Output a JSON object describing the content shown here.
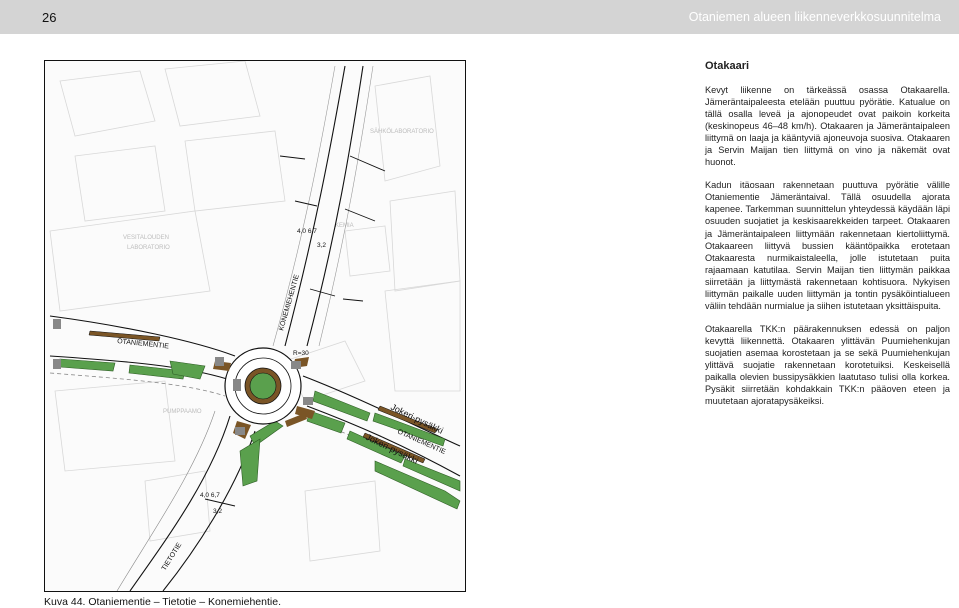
{
  "header": {
    "page_number": "26",
    "title": "Otaniemen alueen liikenneverkkosuunnitelma"
  },
  "map": {
    "street_labels": {
      "otaniementie_west": "OTANIEMENTIE",
      "konemiehentie": "KONEMIEHENTIE",
      "otaniementie_east": "OTANIEMENTIE",
      "tietotie": "TIETOTIE"
    },
    "stop_labels": {
      "jokeri_stop_north": "Jokeri-pysäkki",
      "jokeri_stop_south": "Jokeri-pysäkki"
    },
    "dimension_labels": {
      "north_widths": "4,0 6,7",
      "north_extra": "3,2",
      "south_widths": "4,0 6,7",
      "south_extra": "3,2",
      "roundabout_radius": "R=30"
    },
    "background_labels": {
      "lab_name": "VESITALOUDEN",
      "lab_name2": "LABORATORIO",
      "sahko": "SÄHKÖLABORATORIO",
      "kemia": "KEMIA",
      "pumppaamo": "PUMPPAAMO"
    }
  },
  "caption": "Kuva 44.  Otaniementie – Tietotie – Konemiehentie.",
  "text": {
    "title": "Otakaari",
    "paragraphs": [
      "Kevyt liikenne on tärkeässä osassa Otakaarella. Jämeräntaipaleesta etelään puuttuu pyörätie. Katualue on tällä osalla leveä ja ajonopeudet ovat paikoin korkeita (keskinopeus 46–48 km/h). Otakaaren ja Jämeräntaipaleen liittymä on laaja ja kääntyviä ajoneuvoja suosiva. Otakaaren ja Servin Maijan tien liittymä on vino ja näkemät ovat huonot.",
      "Kadun itäosaan rakennetaan puuttuva pyörätie välille Otaniementie Jämeräntaival. Tällä osuudella ajorata kapenee. Tarkemman suunnittelun yhteydessä käydään läpi osuuden suojatiet ja keskisaarekkeiden tarpeet. Otakaaren ja Jämeräntaipaleen liittymään rakennetaan kiertoliittymä. Otakaareen liittyvä bussien kääntöpaikka erotetaan Otakaaresta nurmikaistaleella, jolle istutetaan puita rajaamaan katutilaa. Servin Maijan tien liittymän paikkaa siirretään ja liittymästä rakennetaan kohtisuora. Nykyisen liittymän paikalle uuden liittymän ja tontin pysäköintialueen väliin tehdään nurmialue ja siihen istutetaan yksittäispuita.",
      "Otakaarella TKK:n päärakennuksen edessä on paljon kevyttä liikennettä. Otakaaren ylittävän Puumiehenkujan suojatien asemaa korostetaan ja se sekä Puumiehenkujan ylittävä suojatie rakennetaan korotetuiksi. Keskeisellä paikalla olevien bussipysäkkien laatutaso tulisi olla korkea. Pysäkit siirretään kohdakkain TKK:n pääoven eteen ja muutetaan ajoratapysäkeiksi."
    ]
  },
  "colors": {
    "header_bg": "#d4d4d4",
    "green": "#5aa04d",
    "brown": "#7a5526",
    "road_line": "#111111"
  }
}
